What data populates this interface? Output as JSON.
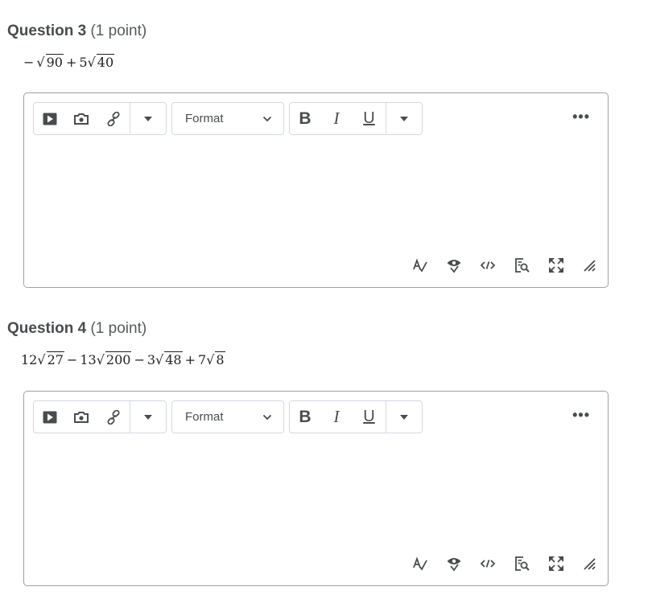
{
  "questions": [
    {
      "number_label": "Question 3",
      "points_label": "(1 point)",
      "expression": [
        {
          "t": "op",
          "v": "−"
        },
        {
          "t": "rad",
          "v": "90"
        },
        {
          "t": "op",
          "v": "+"
        },
        {
          "t": "num",
          "v": "5"
        },
        {
          "t": "rad",
          "v": "40"
        }
      ]
    },
    {
      "number_label": "Question 4",
      "points_label": "(1 point)",
      "expression": [
        {
          "t": "num",
          "v": "12"
        },
        {
          "t": "rad",
          "v": "27"
        },
        {
          "t": "op",
          "v": "−"
        },
        {
          "t": "num",
          "v": "13"
        },
        {
          "t": "rad",
          "v": "200"
        },
        {
          "t": "op",
          "v": "−"
        },
        {
          "t": "num",
          "v": "3"
        },
        {
          "t": "rad",
          "v": "48"
        },
        {
          "t": "op",
          "v": "+"
        },
        {
          "t": "num",
          "v": "7"
        },
        {
          "t": "rad",
          "v": "8"
        }
      ]
    }
  ],
  "editor": {
    "format_label": "Format",
    "bold_label": "B",
    "italic_label": "I",
    "underline_label": "U",
    "more_label": "•••",
    "toolbar_icons": [
      "video-icon",
      "camera-icon",
      "link-icon",
      "caret-down-icon"
    ],
    "status_icons": [
      "spellcheck-icon",
      "accessibility-checker-icon",
      "source-code-icon",
      "preview-icon",
      "fullscreen-icon",
      "resize-handle-icon"
    ]
  },
  "colors": {
    "text": "#494c4e",
    "border": "#9fa2a4",
    "toolbar_border": "#d3d9e3",
    "background": "#ffffff"
  }
}
